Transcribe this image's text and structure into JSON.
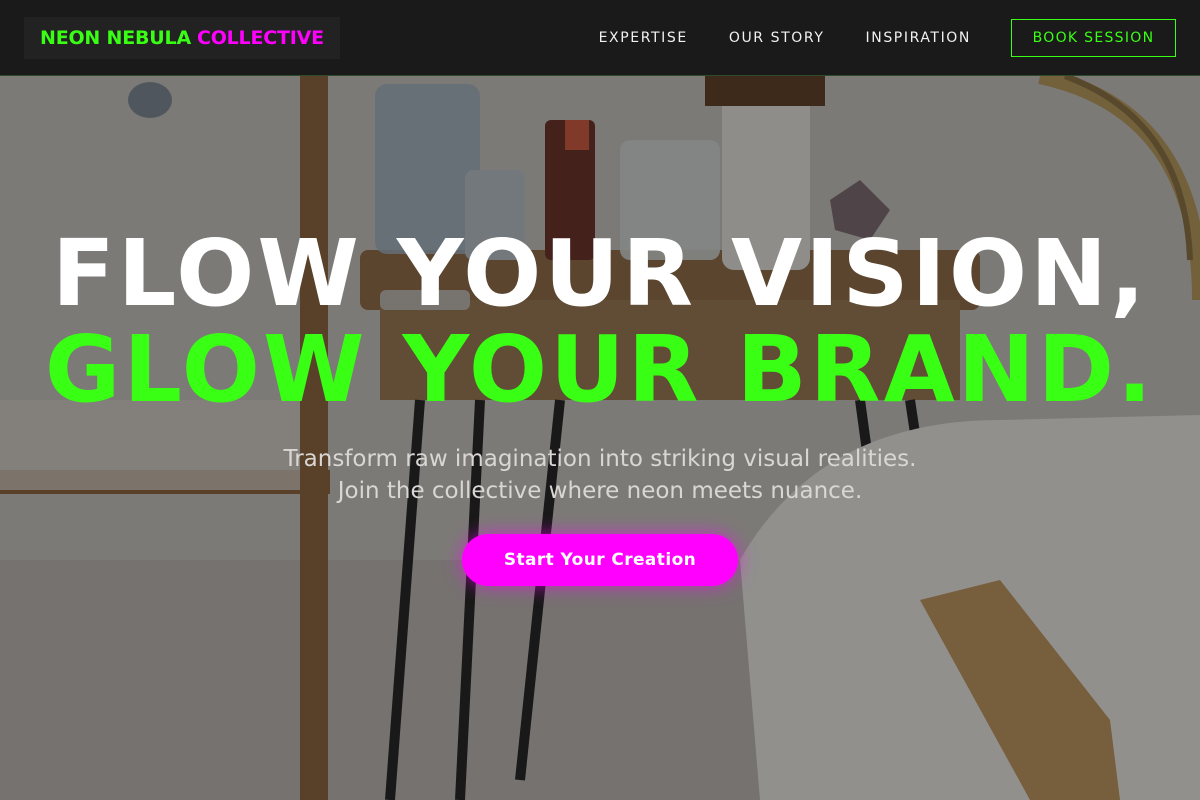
{
  "brand": {
    "part1": "NEON NEBULA",
    "part2": "COLLECTIVE"
  },
  "nav": {
    "links": [
      "EXPERTISE",
      "OUR STORY",
      "INSPIRATION"
    ],
    "cta_label": "BOOK SESSION"
  },
  "hero": {
    "headline_line1": "FLOW YOUR VISION,",
    "headline_line2": "GLOW YOUR BRAND.",
    "subtitle_line1": "Transform raw imagination into striking visual realities.",
    "subtitle_line2": "Join the collective where neon meets nuance.",
    "cta_label": "Start Your Creation",
    "background_image_icon": "art-studio-photo"
  },
  "colors": {
    "neon_green": "#39ff14",
    "neon_pink": "#ff00ff",
    "nav_bg": "#1a1a1a"
  }
}
